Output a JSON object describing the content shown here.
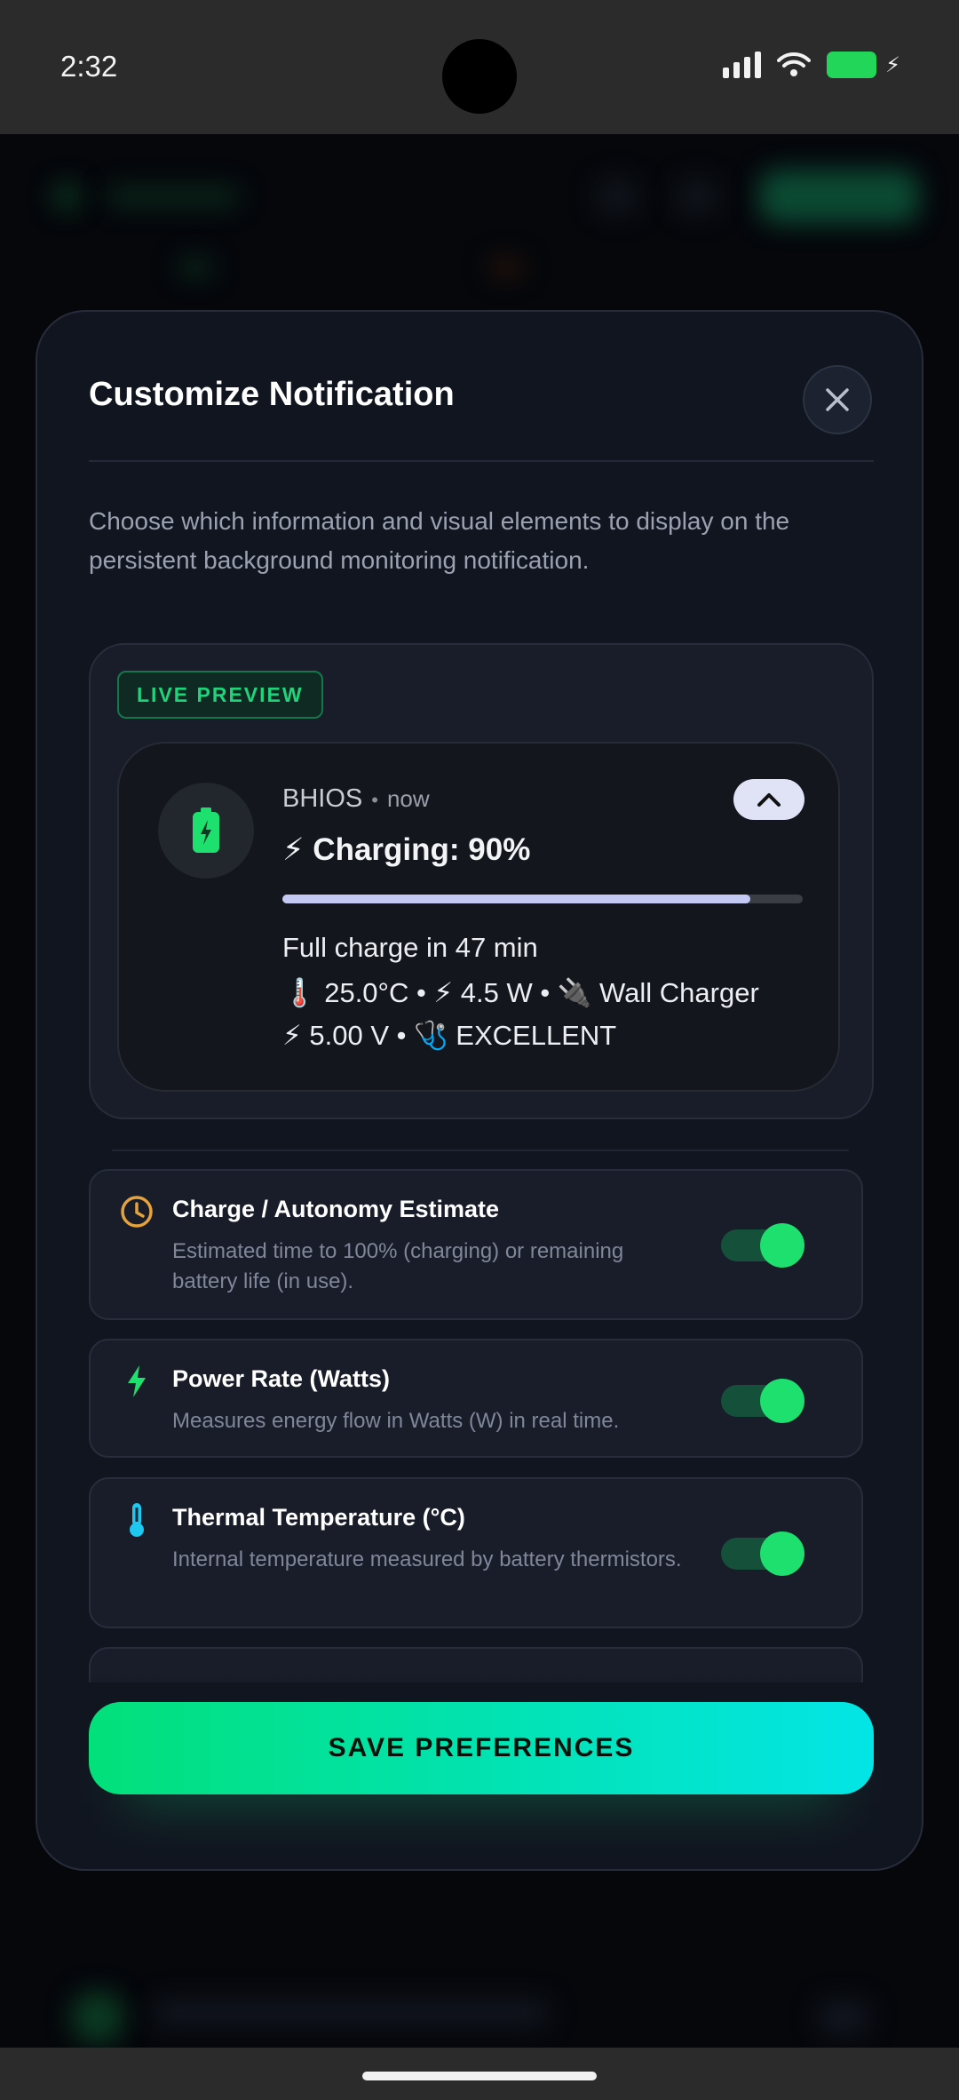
{
  "status_bar": {
    "time": "2:32"
  },
  "sheet": {
    "title": "Customize Notification",
    "description": "Choose which information and visual elements to display on the persistent background monitoring notification.",
    "live_preview_label": "LIVE PREVIEW"
  },
  "notification": {
    "app_name": "BHIOS",
    "separator": "•",
    "time": "now",
    "title": "⚡ Charging: 90%",
    "progress": 0.9,
    "line1": "Full charge in 47 min",
    "line2": "🌡️ 25.0°C • ⚡ 4.5 W • 🔌 Wall Charger",
    "line3": "⚡ 5.00 V • 🩺 EXCELLENT"
  },
  "options": [
    {
      "title": "Charge / Autonomy Estimate",
      "description": "Estimated time to 100% (charging) or remaining battery life (in use).",
      "icon": "clock-icon",
      "enabled": true
    },
    {
      "title": "Power Rate (Watts)",
      "description": "Measures energy flow in Watts (W) in real time.",
      "icon": "bolt-icon",
      "enabled": true
    },
    {
      "title": "Thermal Temperature (°C)",
      "description": "Internal temperature measured by battery thermistors.",
      "icon": "thermometer-icon",
      "enabled": true
    }
  ],
  "save_label": "SAVE PREFERENCES",
  "colors": {
    "accent_green": "#1ee06e",
    "accent_cyan": "#03e5e6",
    "sheet_bg": "#11151f",
    "badge_green": "#1fd47a",
    "clock_orange": "#e6a23c",
    "thermo_cyan": "#1ec8f0"
  }
}
